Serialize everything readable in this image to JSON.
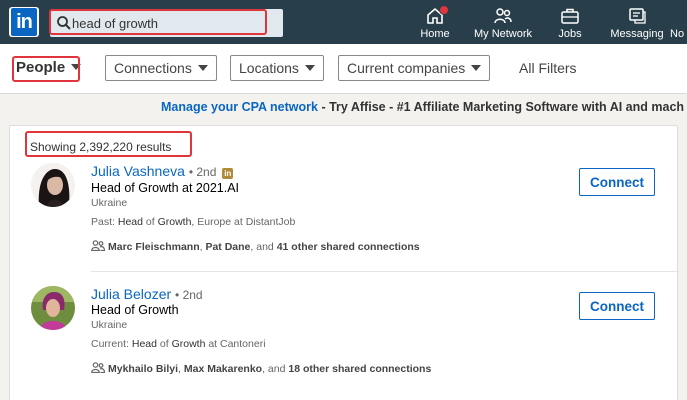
{
  "nav": {
    "logo_text": "in",
    "search_value": "head of growth",
    "items": [
      {
        "label": "Home",
        "icon": "home-icon"
      },
      {
        "label": "My Network",
        "icon": "my-network-icon"
      },
      {
        "label": "Jobs",
        "icon": "briefcase-icon"
      },
      {
        "label": "Messaging",
        "icon": "messaging-icon"
      },
      {
        "label": "No",
        "icon": "notifications-icon"
      }
    ]
  },
  "filters": {
    "people": "People",
    "connections": "Connections",
    "locations": "Locations",
    "current_companies": "Current companies",
    "all_filters": "All Filters"
  },
  "ad": {
    "link_text": "Manage your CPA network",
    "separator": " - ",
    "body_text": "Try Affise - #1 Affiliate Marketing Software with AI and mach"
  },
  "results": {
    "count_text": "Showing 2,392,220 results",
    "people": [
      {
        "name": "Julia Vashneva",
        "degree": "• 2nd",
        "premium_badge": "in",
        "title": "Head of Growth at 2021.AI",
        "location": "Ukraine",
        "experience_prefix": "Past: ",
        "experience_bold1": "Head",
        "experience_mid": " of ",
        "experience_bold2": "Growth",
        "experience_suffix": ", Europe at DistantJob",
        "shared_name1": "Marc Fleischmann",
        "shared_sep": ", ",
        "shared_name2": "Pat Dane",
        "shared_and": ", and ",
        "shared_count": "41 other shared connections",
        "connect_label": "Connect"
      },
      {
        "name": "Julia Belozer",
        "degree": "• 2nd",
        "title": "Head of Growth",
        "location": "Ukraine",
        "experience_prefix": "Current: ",
        "experience_bold1": "Head",
        "experience_mid": " of ",
        "experience_bold2": "Growth",
        "experience_suffix": " at Cantoneri",
        "shared_name1": "Mykhailo Bilyi",
        "shared_sep": ", ",
        "shared_name2": "Max Makarenko",
        "shared_and": ", and ",
        "shared_count": "18 other shared connections",
        "connect_label": "Connect"
      }
    ]
  },
  "colors": {
    "nav_bg": "#283e4a",
    "brand_blue": "#0a66c2",
    "highlight_red": "#e0353c"
  }
}
